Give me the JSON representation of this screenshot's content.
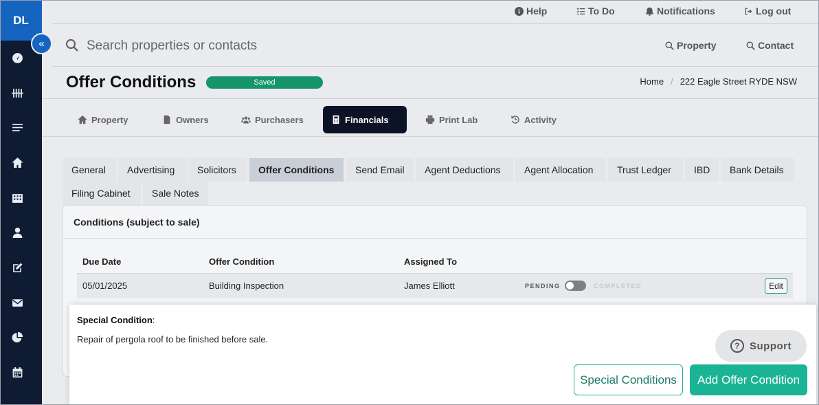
{
  "user": {
    "initials": "DL"
  },
  "topbar": {
    "help": "Help",
    "todo": "To Do",
    "notifications": "Notifications",
    "logout": "Log out"
  },
  "search": {
    "placeholder": "Search properties or contacts",
    "scope_property": "Property",
    "scope_contact": "Contact"
  },
  "page": {
    "title": "Offer Conditions",
    "status": "Saved",
    "breadcrumb": {
      "home": "Home",
      "separator": "/",
      "current": "222 Eagle Street RYDE NSW"
    }
  },
  "main_tabs": [
    {
      "label": "Property"
    },
    {
      "label": "Owners"
    },
    {
      "label": "Purchasers"
    },
    {
      "label": "Financials"
    },
    {
      "label": "Print Lab"
    },
    {
      "label": "Activity"
    }
  ],
  "sub_tabs": [
    {
      "label": "General"
    },
    {
      "label": "Advertising"
    },
    {
      "label": "Solicitors"
    },
    {
      "label": "Offer Conditions"
    },
    {
      "label": "Send Email"
    },
    {
      "label": "Agent Deductions"
    },
    {
      "label": "Agent Allocation"
    },
    {
      "label": "Trust Ledger"
    },
    {
      "label": "IBD"
    },
    {
      "label": "Bank Details"
    },
    {
      "label": "Filing Cabinet"
    },
    {
      "label": "Sale Notes"
    }
  ],
  "conditions": {
    "title": "Conditions (subject to sale)",
    "columns": [
      "Due Date",
      "Offer Condition",
      "Assigned To"
    ],
    "rows": [
      {
        "due_date": "05/01/2025",
        "condition": "Building Inspection",
        "assigned_to": "James Elliott",
        "status_left": "PENDING",
        "status_right": "COMPLETED",
        "edit_label": "Edit"
      }
    ]
  },
  "special": {
    "label": "Special Condition",
    "colon": ":",
    "text": "Repair of pergola roof to be finished before sale."
  },
  "support": {
    "label": "Support"
  },
  "actions": {
    "special_conditions": "Special Conditions",
    "add_offer_condition": "Add Offer Condition"
  },
  "colors": {
    "accent": "#1ab394",
    "saved": "#16946a",
    "nav": "#0f1b33",
    "brand_blue": "#1565c0"
  }
}
